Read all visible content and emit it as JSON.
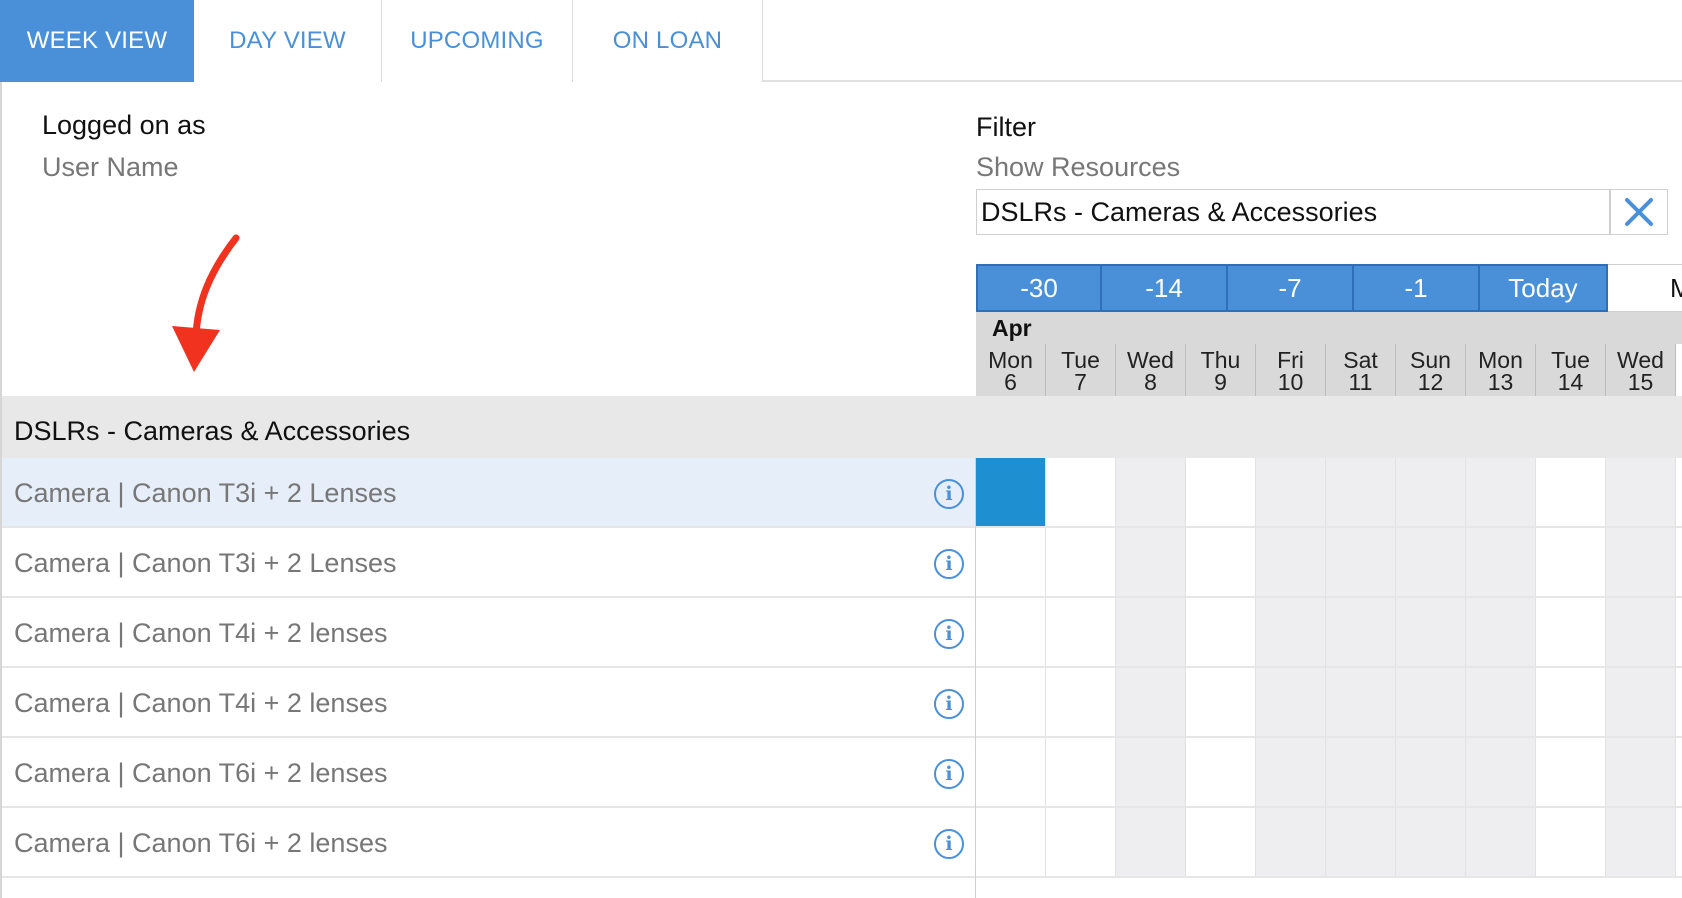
{
  "tabs": [
    {
      "label": "WEEK VIEW",
      "active": true
    },
    {
      "label": "DAY VIEW",
      "active": false
    },
    {
      "label": "UPCOMING",
      "active": false
    },
    {
      "label": "ON LOAN",
      "active": false
    }
  ],
  "user": {
    "label": "Logged on as",
    "name": "User Name"
  },
  "filter": {
    "label": "Filter",
    "sublabel": "Show Resources",
    "value": "DSLRs - Cameras & Accessories",
    "clear_icon": "close-icon"
  },
  "nav": {
    "buttons": [
      "-30",
      "-14",
      "-7",
      "-1",
      "Today"
    ],
    "next_partial": "M"
  },
  "calendar": {
    "month": "Apr",
    "days": [
      {
        "dow": "Mon",
        "day": "6"
      },
      {
        "dow": "Tue",
        "day": "7"
      },
      {
        "dow": "Wed",
        "day": "8"
      },
      {
        "dow": "Thu",
        "day": "9"
      },
      {
        "dow": "Fri",
        "day": "10"
      },
      {
        "dow": "Sat",
        "day": "11"
      },
      {
        "dow": "Sun",
        "day": "12"
      },
      {
        "dow": "Mon",
        "day": "13"
      },
      {
        "dow": "Tue",
        "day": "14"
      },
      {
        "dow": "Wed",
        "day": "15"
      }
    ]
  },
  "group": {
    "title": "DSLRs - Cameras & Accessories"
  },
  "resources": [
    {
      "name": "Camera | Canon T3i + 2 Lenses",
      "selected": true,
      "booked_days": [
        0
      ]
    },
    {
      "name": "Camera | Canon T3i + 2 Lenses",
      "selected": false,
      "booked_days": []
    },
    {
      "name": "Camera | Canon T4i + 2 lenses",
      "selected": false,
      "booked_days": []
    },
    {
      "name": "Camera | Canon T4i + 2 lenses",
      "selected": false,
      "booked_days": []
    },
    {
      "name": "Camera | Canon T6i + 2 lenses",
      "selected": false,
      "booked_days": []
    },
    {
      "name": "Camera | Canon T6i + 2 lenses",
      "selected": false,
      "booked_days": []
    }
  ],
  "weekend_columns": [
    2,
    4,
    5,
    6,
    7,
    9
  ],
  "colors": {
    "accent": "#4a90d9",
    "booking": "#1e8fd0",
    "selected_row": "#e6eef9",
    "annotation_arrow": "#f0321e"
  }
}
